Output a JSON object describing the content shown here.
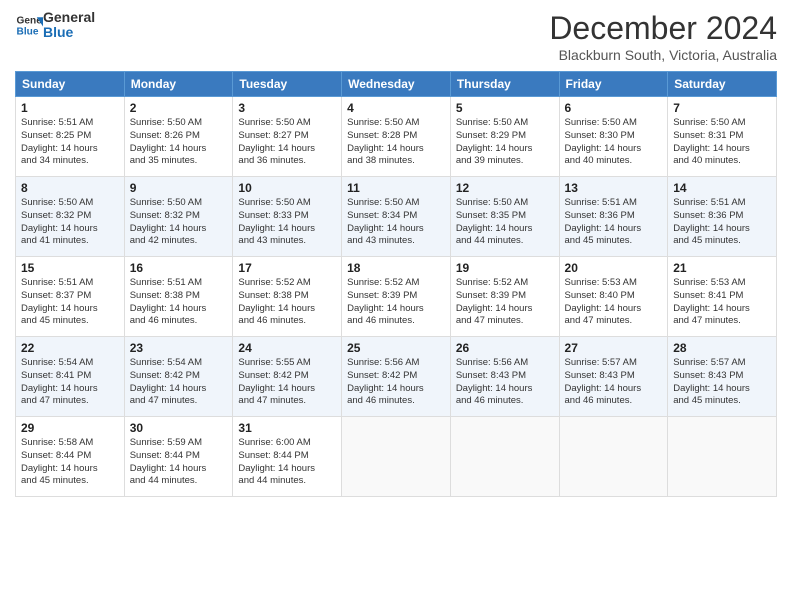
{
  "logo": {
    "line1": "General",
    "line2": "Blue"
  },
  "title": "December 2024",
  "subtitle": "Blackburn South, Victoria, Australia",
  "weekdays": [
    "Sunday",
    "Monday",
    "Tuesday",
    "Wednesday",
    "Thursday",
    "Friday",
    "Saturday"
  ],
  "weeks": [
    [
      {
        "day": "1",
        "info": "Sunrise: 5:51 AM\nSunset: 8:25 PM\nDaylight: 14 hours\nand 34 minutes."
      },
      {
        "day": "2",
        "info": "Sunrise: 5:50 AM\nSunset: 8:26 PM\nDaylight: 14 hours\nand 35 minutes."
      },
      {
        "day": "3",
        "info": "Sunrise: 5:50 AM\nSunset: 8:27 PM\nDaylight: 14 hours\nand 36 minutes."
      },
      {
        "day": "4",
        "info": "Sunrise: 5:50 AM\nSunset: 8:28 PM\nDaylight: 14 hours\nand 38 minutes."
      },
      {
        "day": "5",
        "info": "Sunrise: 5:50 AM\nSunset: 8:29 PM\nDaylight: 14 hours\nand 39 minutes."
      },
      {
        "day": "6",
        "info": "Sunrise: 5:50 AM\nSunset: 8:30 PM\nDaylight: 14 hours\nand 40 minutes."
      },
      {
        "day": "7",
        "info": "Sunrise: 5:50 AM\nSunset: 8:31 PM\nDaylight: 14 hours\nand 40 minutes."
      }
    ],
    [
      {
        "day": "8",
        "info": "Sunrise: 5:50 AM\nSunset: 8:32 PM\nDaylight: 14 hours\nand 41 minutes."
      },
      {
        "day": "9",
        "info": "Sunrise: 5:50 AM\nSunset: 8:32 PM\nDaylight: 14 hours\nand 42 minutes."
      },
      {
        "day": "10",
        "info": "Sunrise: 5:50 AM\nSunset: 8:33 PM\nDaylight: 14 hours\nand 43 minutes."
      },
      {
        "day": "11",
        "info": "Sunrise: 5:50 AM\nSunset: 8:34 PM\nDaylight: 14 hours\nand 43 minutes."
      },
      {
        "day": "12",
        "info": "Sunrise: 5:50 AM\nSunset: 8:35 PM\nDaylight: 14 hours\nand 44 minutes."
      },
      {
        "day": "13",
        "info": "Sunrise: 5:51 AM\nSunset: 8:36 PM\nDaylight: 14 hours\nand 45 minutes."
      },
      {
        "day": "14",
        "info": "Sunrise: 5:51 AM\nSunset: 8:36 PM\nDaylight: 14 hours\nand 45 minutes."
      }
    ],
    [
      {
        "day": "15",
        "info": "Sunrise: 5:51 AM\nSunset: 8:37 PM\nDaylight: 14 hours\nand 45 minutes."
      },
      {
        "day": "16",
        "info": "Sunrise: 5:51 AM\nSunset: 8:38 PM\nDaylight: 14 hours\nand 46 minutes."
      },
      {
        "day": "17",
        "info": "Sunrise: 5:52 AM\nSunset: 8:38 PM\nDaylight: 14 hours\nand 46 minutes."
      },
      {
        "day": "18",
        "info": "Sunrise: 5:52 AM\nSunset: 8:39 PM\nDaylight: 14 hours\nand 46 minutes."
      },
      {
        "day": "19",
        "info": "Sunrise: 5:52 AM\nSunset: 8:39 PM\nDaylight: 14 hours\nand 47 minutes."
      },
      {
        "day": "20",
        "info": "Sunrise: 5:53 AM\nSunset: 8:40 PM\nDaylight: 14 hours\nand 47 minutes."
      },
      {
        "day": "21",
        "info": "Sunrise: 5:53 AM\nSunset: 8:41 PM\nDaylight: 14 hours\nand 47 minutes."
      }
    ],
    [
      {
        "day": "22",
        "info": "Sunrise: 5:54 AM\nSunset: 8:41 PM\nDaylight: 14 hours\nand 47 minutes."
      },
      {
        "day": "23",
        "info": "Sunrise: 5:54 AM\nSunset: 8:42 PM\nDaylight: 14 hours\nand 47 minutes."
      },
      {
        "day": "24",
        "info": "Sunrise: 5:55 AM\nSunset: 8:42 PM\nDaylight: 14 hours\nand 47 minutes."
      },
      {
        "day": "25",
        "info": "Sunrise: 5:56 AM\nSunset: 8:42 PM\nDaylight: 14 hours\nand 46 minutes."
      },
      {
        "day": "26",
        "info": "Sunrise: 5:56 AM\nSunset: 8:43 PM\nDaylight: 14 hours\nand 46 minutes."
      },
      {
        "day": "27",
        "info": "Sunrise: 5:57 AM\nSunset: 8:43 PM\nDaylight: 14 hours\nand 46 minutes."
      },
      {
        "day": "28",
        "info": "Sunrise: 5:57 AM\nSunset: 8:43 PM\nDaylight: 14 hours\nand 45 minutes."
      }
    ],
    [
      {
        "day": "29",
        "info": "Sunrise: 5:58 AM\nSunset: 8:44 PM\nDaylight: 14 hours\nand 45 minutes."
      },
      {
        "day": "30",
        "info": "Sunrise: 5:59 AM\nSunset: 8:44 PM\nDaylight: 14 hours\nand 44 minutes."
      },
      {
        "day": "31",
        "info": "Sunrise: 6:00 AM\nSunset: 8:44 PM\nDaylight: 14 hours\nand 44 minutes."
      },
      null,
      null,
      null,
      null
    ]
  ]
}
